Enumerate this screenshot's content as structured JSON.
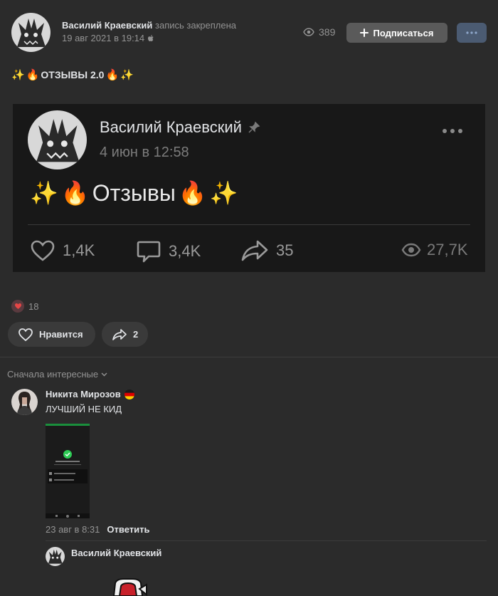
{
  "post": {
    "author": "Василий Краевский",
    "pinned_text": "запись закреплена",
    "date": "19 авг 2021 в 19:14",
    "views": "389",
    "subscribe_label": "Подписаться",
    "text": "ОТЗЫВЫ 2.0",
    "reactions_count": "18",
    "like_label": "Нравится",
    "share_count": "2"
  },
  "embed": {
    "author": "Василий Краевский",
    "date": "4 июн в 12:58",
    "title": "Отзывы",
    "likes": "1,4K",
    "comments": "3,4K",
    "shares": "35",
    "views": "27,7K"
  },
  "comments": {
    "sort_label": "Сначала интересные",
    "items": [
      {
        "author": "Никита Мирозов",
        "text": "ЛУЧШИЙ НЕ КИД",
        "date": "23 авг в 8:31",
        "reply_label": "Ответить"
      }
    ],
    "reply_author": "Василий Краевский"
  },
  "colors": {
    "background": "#2b2b2b",
    "embed_bg": "#181818",
    "subscribe_btn": "#5a5a5a",
    "more_btn": "#4b5b72",
    "heart_red": "#e64646"
  }
}
